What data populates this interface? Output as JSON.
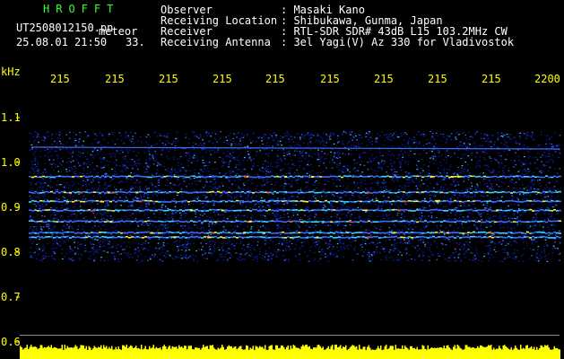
{
  "header": {
    "app_title": "HROFFT",
    "file_name": "UT2508012150.pn",
    "file_suffix": "meteor",
    "datetime": "25.08.01 21:50",
    "count": "33.",
    "info_labels": [
      "Observer",
      "Receiving Location",
      "Receiver",
      "Receiving Antenna"
    ],
    "info_values": [
      ": Masaki Kano",
      ": Shibukawa, Gunma, Japan",
      ": RTL-SDR SDR# 43dB L15 103.2MHz CW",
      ": 3el Yagi(V) Az 330 for Vladivostok"
    ]
  },
  "time_axis": {
    "labels": [
      "215",
      "215",
      "215",
      "215",
      "215",
      "215",
      "215",
      "215",
      "215",
      "2200"
    ]
  },
  "freq_axis": {
    "unit": "kHz",
    "labels": [
      "1.1",
      "1.0",
      "0.9",
      "0.8",
      "0.7",
      "0.6"
    ],
    "values": [
      1.1,
      1.0,
      0.9,
      0.8,
      0.7,
      0.6
    ]
  },
  "colors": {
    "background": "#000000",
    "header_text": "#ffffff",
    "title_green": "#33ff33",
    "axis_yellow": "#ffff00",
    "noise_blue": "#0a1fa8",
    "bright_blue": "#3c6cff",
    "cyan": "#35d6ff",
    "yellow_line": "#ffe83a",
    "red_spot": "#ff4020"
  },
  "spectrum": {
    "band_top_khz": 1.07,
    "band_bottom_khz": 0.78,
    "carrier_lines_khz": [
      0.97,
      0.935,
      0.915,
      0.895,
      0.87,
      0.845,
      0.835
    ],
    "baseline_line_khz": 0.615
  }
}
